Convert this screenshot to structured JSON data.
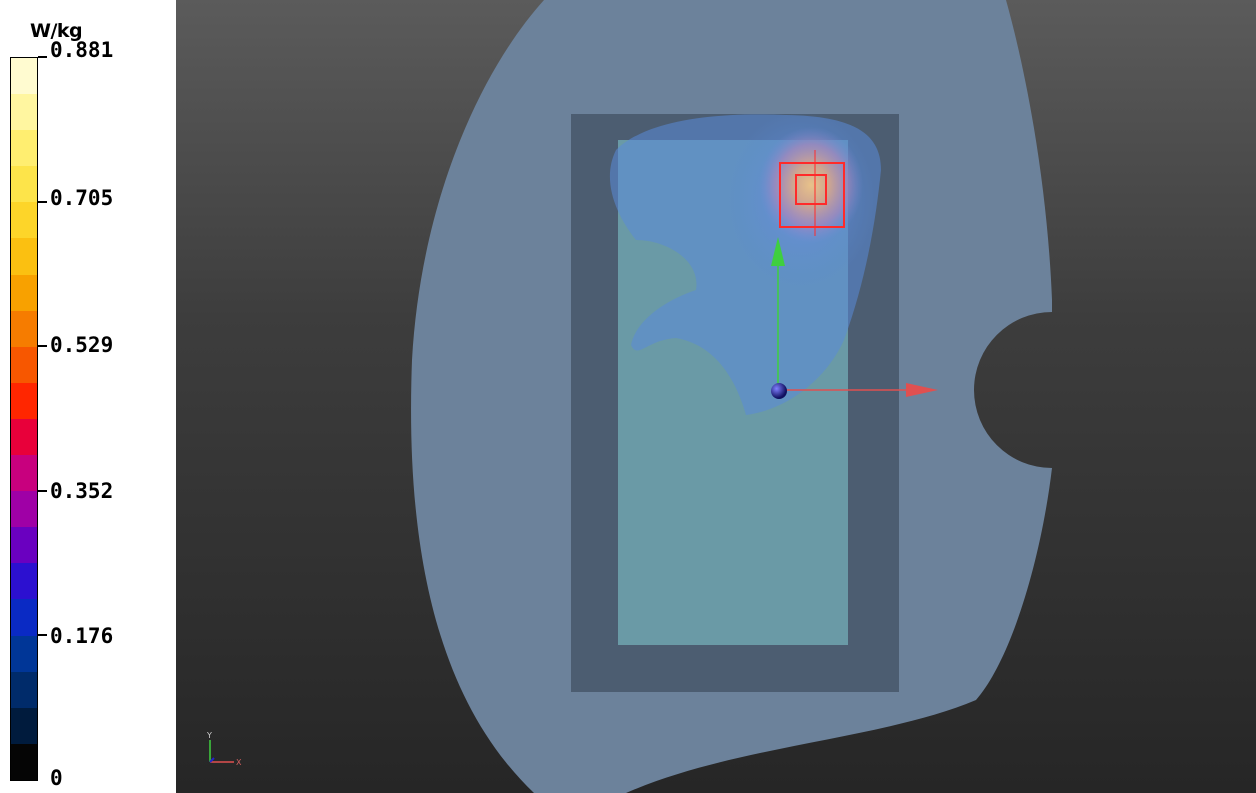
{
  "legend": {
    "unit": "W/kg",
    "max_label": "0.881",
    "labels": [
      "0.881",
      "0.705",
      "0.529",
      "0.352",
      "0.176",
      "0"
    ],
    "bands": [
      "#fffbd0",
      "#fff6a0",
      "#ffee70",
      "#fde44a",
      "#fdd529",
      "#fbc011",
      "#f8a100",
      "#f67c00",
      "#f75700",
      "#ff2600",
      "#e8003a",
      "#c8007e",
      "#9f00a6",
      "#6a00c0",
      "#2c10d0",
      "#0a2ac4",
      "#003697",
      "#002b6a",
      "#001b3d",
      "#050505"
    ]
  },
  "viewport": {
    "colors": {
      "phantom": "#6c829b",
      "device": "#4c5d71",
      "screen": "#6a9aa6",
      "hotspot": "#d97590",
      "peak_box": "#ff2a2a",
      "axis_x": "#e05050",
      "axis_y": "#3fcf3f",
      "origin": "#2424c8"
    }
  }
}
